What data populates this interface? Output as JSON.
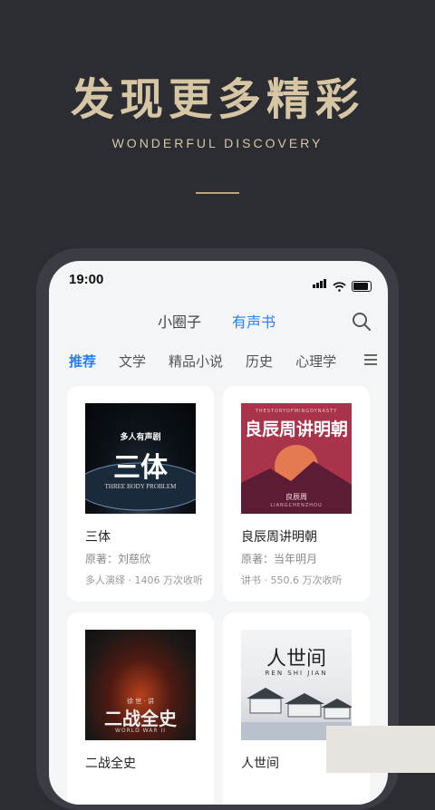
{
  "hero": {
    "title": "发现更多精彩",
    "subtitle": "WONDERFUL DISCOVERY"
  },
  "status_bar": {
    "time": "19:00"
  },
  "top_tabs": [
    {
      "label": "小圈子",
      "active": false
    },
    {
      "label": "有声书",
      "active": true
    }
  ],
  "categories": [
    {
      "label": "推荐",
      "active": true
    },
    {
      "label": "文学",
      "active": false
    },
    {
      "label": "精品小说",
      "active": false
    },
    {
      "label": "历史",
      "active": false
    },
    {
      "label": "心理学",
      "active": false
    }
  ],
  "books": [
    {
      "title": "三体",
      "author": "原著：刘慈欣",
      "meta": "多人演绎 · 1406 万次收听",
      "cover_tag": "多人有声剧",
      "cover_title": "三体",
      "cover_sub": "THREE BODY PROBLEM"
    },
    {
      "title": "良辰周讲明朝",
      "author": "原著：当年明月",
      "meta": "讲书 · 550.6 万次收听",
      "cover_top": "THESTORYOFMINGDYNASTY",
      "cover_title": "良辰周讲明朝",
      "cover_name": "良辰周",
      "cover_bottom": "LIANGCHENZHOU"
    },
    {
      "title": "二战全史",
      "cover_small": "徐 世 · 讲",
      "cover_title": "二战全史",
      "cover_sub": "WORLD WAR II"
    },
    {
      "title": "人世间",
      "cover_title": "人世间",
      "cover_sub": "REN SHI JIAN"
    }
  ],
  "colors": {
    "background": "#2b2d32",
    "accent_gold": "#d7c6a3",
    "active_blue": "#2a7df2",
    "screen_bg": "#f4f5f7"
  }
}
